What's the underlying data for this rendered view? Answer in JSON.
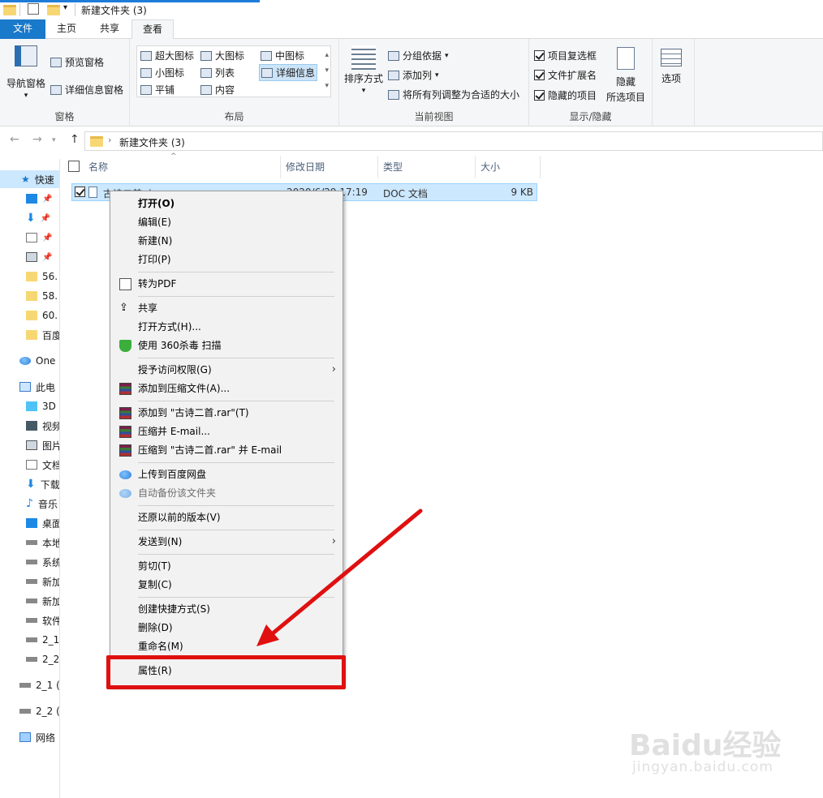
{
  "window": {
    "title": "新建文件夹 (3)"
  },
  "ribbon_tabs": [
    "文件",
    "主页",
    "共享",
    "查看"
  ],
  "ribbon": {
    "pane_group": {
      "label": "窗格",
      "nav_pane": "导航窗格",
      "preview_pane": "预览窗格",
      "details_pane": "详细信息窗格"
    },
    "layout_group": {
      "label": "布局",
      "items": [
        "超大图标",
        "大图标",
        "中图标",
        "小图标",
        "列表",
        "详细信息",
        "平铺",
        "内容"
      ],
      "selected": "详细信息"
    },
    "current_view_group": {
      "label": "当前视图",
      "sort_by": "排序方式",
      "group_by": "分组依据",
      "add_column": "添加列",
      "fit_columns": "将所有列调整为合适的大小"
    },
    "show_hide_group": {
      "label": "显示/隐藏",
      "item_checkboxes": "项目复选框",
      "file_extensions": "文件扩展名",
      "hidden_items": "隐藏的项目",
      "hide_selected_line1": "隐藏",
      "hide_selected_line2": "所选项目"
    },
    "options": "选项"
  },
  "address": {
    "path": "新建文件夹 (3)"
  },
  "nav_pane": {
    "items": [
      "快速",
      "",
      "",
      "",
      "",
      "56.",
      "58.",
      "60.",
      "百度",
      "One",
      "此电",
      "3D",
      "视频",
      "图片",
      "文档",
      "下载",
      "音乐",
      "桌面",
      "本地",
      "系统",
      "新加",
      "新加",
      "软件",
      "2_1",
      "2_2",
      "2_1 (",
      "2_2 (",
      "网络"
    ]
  },
  "columns": {
    "name": "名称",
    "modified": "修改日期",
    "type": "类型",
    "size": "大小"
  },
  "file": {
    "name": "古诗二首.doc",
    "modified": "2020/6/29 17:19",
    "type": "DOC 文档",
    "size": "9 KB"
  },
  "context_menu": {
    "items": [
      "打开(O)",
      "编辑(E)",
      "新建(N)",
      "打印(P)",
      "转为PDF",
      "共享",
      "打开方式(H)...",
      "使用 360杀毒 扫描",
      "授予访问权限(G)",
      "添加到压缩文件(A)...",
      "添加到 \"古诗二首.rar\"(T)",
      "压缩并 E-mail...",
      "压缩到 \"古诗二首.rar\" 并 E-mail",
      "上传到百度网盘",
      "自动备份该文件夹",
      "还原以前的版本(V)",
      "发送到(N)",
      "剪切(T)",
      "复制(C)",
      "创建快捷方式(S)",
      "删除(D)",
      "重命名(M)",
      "属性(R)"
    ]
  },
  "watermark": {
    "brand": "Baidu经验",
    "url": "jingyan.baidu.com"
  },
  "colors": {
    "accent": "#1979ca",
    "selection": "#cce8ff",
    "annotation": "#e01010"
  }
}
